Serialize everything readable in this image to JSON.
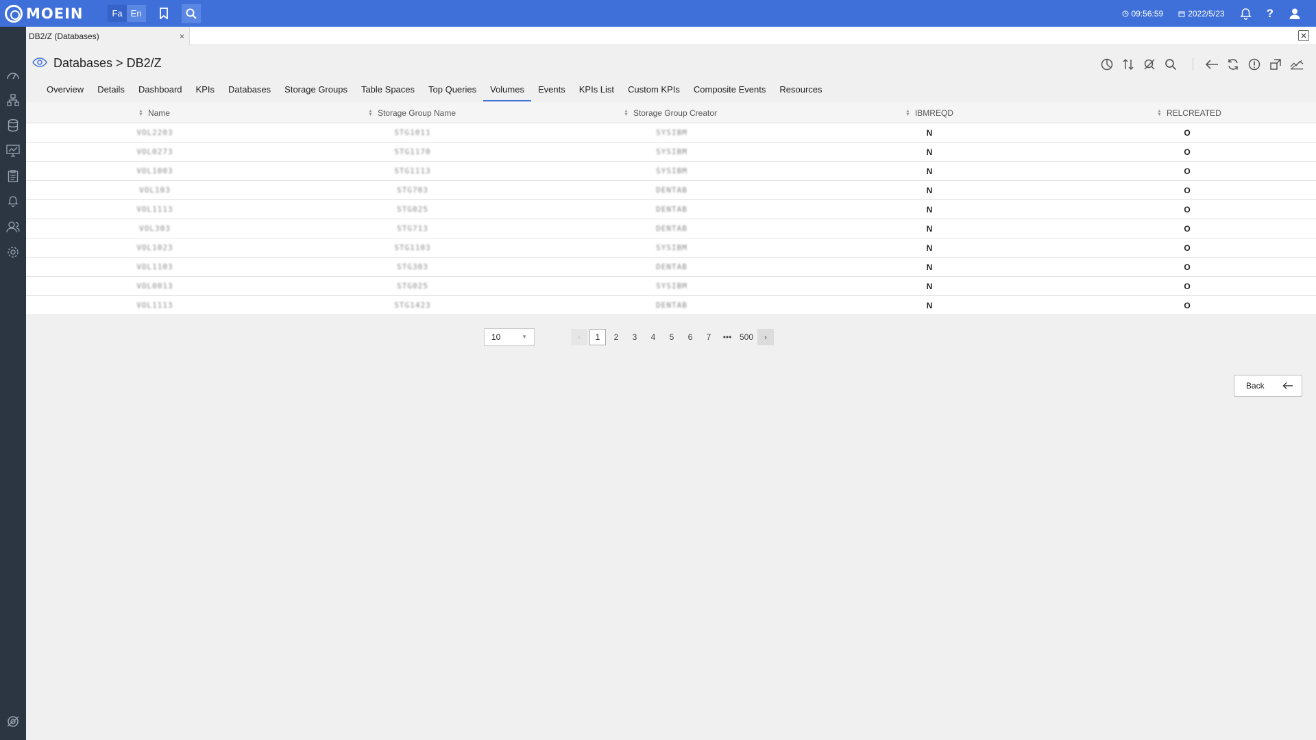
{
  "topbar": {
    "logo_text": "MOEIN",
    "lang_fa": "Fa",
    "lang_en": "En",
    "time": "09:56:59",
    "date": "2022/5/23",
    "icons": [
      "bookmark-icon",
      "search-icon",
      "clock-icon",
      "calendar-icon",
      "bell-icon",
      "help-icon",
      "user-icon"
    ],
    "help_label": "?"
  },
  "sidebar": {
    "icons": [
      "dashboard-gauge-icon",
      "topology-icon",
      "database-icon",
      "monitor-icon",
      "report-icon",
      "alert-bell-icon",
      "users-icon",
      "settings-icon",
      "logo-bottom-icon"
    ]
  },
  "doc_tab": {
    "label": "DB2/Z (Databases)",
    "close": "×"
  },
  "page": {
    "title": "Databases > DB2/Z"
  },
  "subtabs": [
    "Overview",
    "Details",
    "Dashboard",
    "KPIs",
    "Databases",
    "Storage Groups",
    "Table Spaces",
    "Top Queries",
    "Volumes",
    "Events",
    "KPIs List",
    "Custom KPIs",
    "Composite Events",
    "Resources"
  ],
  "active_subtab": "Volumes",
  "table": {
    "columns": [
      "Name",
      "Storage Group Name",
      "Storage Group Creator",
      "IBMREQD",
      "RELCREATED"
    ],
    "rows": [
      [
        "VOL2203",
        "STG1011",
        "SYSIBM",
        "N",
        "O"
      ],
      [
        "VOL0273",
        "STG1170",
        "SYSIBM",
        "N",
        "O"
      ],
      [
        "VOL1003",
        "STG1113",
        "SYSIBM",
        "N",
        "O"
      ],
      [
        "VOL103",
        "STG703",
        "DENTAB",
        "N",
        "O"
      ],
      [
        "VOL1113",
        "STG025",
        "DENTAB",
        "N",
        "O"
      ],
      [
        "VOL303",
        "STG713",
        "DENTAB",
        "N",
        "O"
      ],
      [
        "VOL1023",
        "STG1103",
        "SYSIBM",
        "N",
        "O"
      ],
      [
        "VOL1103",
        "STG303",
        "DENTAB",
        "N",
        "O"
      ],
      [
        "VOL0013",
        "STG025",
        "SYSIBM",
        "N",
        "O"
      ],
      [
        "VOL1113",
        "STG1423",
        "DENTAB",
        "N",
        "O"
      ]
    ]
  },
  "pagination": {
    "page_size": "10",
    "pages": [
      "1",
      "2",
      "3",
      "4",
      "5",
      "6",
      "7",
      "•••",
      "500"
    ],
    "current": "1"
  },
  "back_button": {
    "label": "Back"
  },
  "colors": {
    "accent": "#3f6fd8",
    "sidebar": "#2b3642"
  }
}
